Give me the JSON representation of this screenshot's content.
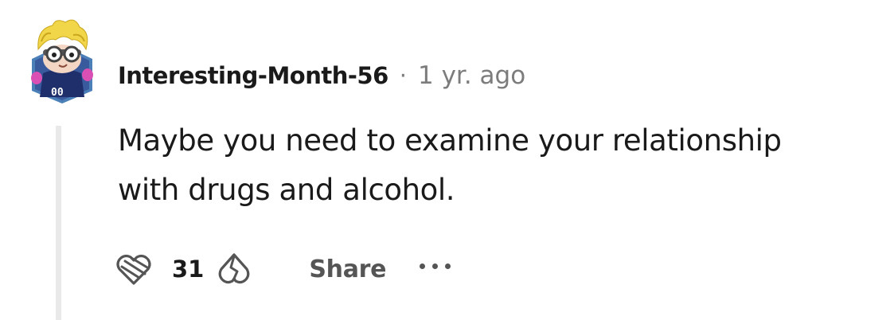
{
  "comment": {
    "author": "Interesting-Month-56",
    "separator": "·",
    "timestamp": "1 yr. ago",
    "body_lines": [
      "Maybe you need to examine your relationship",
      "with drugs and alcohol."
    ],
    "score": "31",
    "share_label": "Share",
    "avatar_badge": "00"
  },
  "icons": {
    "avatar": "snoo-avatar",
    "upvote": "upvote-heart-icon",
    "downvote": "downvote-heart-icon",
    "more": "overflow-menu-icon"
  },
  "colors": {
    "text": "#1a1a1b",
    "meta": "#7c7c7c",
    "thread_line": "#e9e9e9",
    "action": "#555555"
  }
}
